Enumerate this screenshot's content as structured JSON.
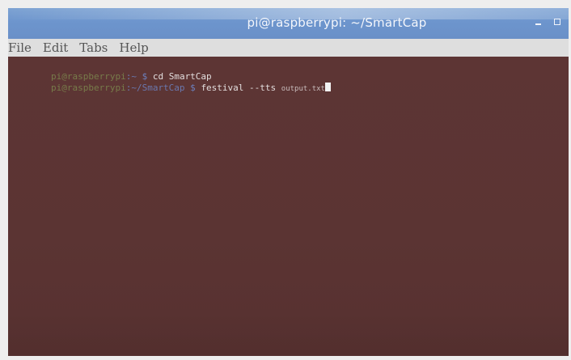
{
  "window": {
    "title": "pi@raspberrypi: ~/SmartCap",
    "controls": {
      "minimize_icon": "minimize-icon",
      "maximize_icon": "maximize-icon"
    }
  },
  "menu": {
    "items": [
      {
        "label": "File"
      },
      {
        "label": "Edit"
      },
      {
        "label": "Tabs"
      },
      {
        "label": "Help"
      }
    ]
  },
  "terminal": {
    "lines": [
      {
        "user": "pi@raspberrypi",
        "path": ":~",
        "symbol": " $ ",
        "command": "cd SmartCap",
        "arg": ""
      },
      {
        "user": "pi@raspberrypi",
        "path": ":~/SmartCap",
        "symbol": " $ ",
        "command": "festival --tts ",
        "arg": "output.txt"
      }
    ]
  },
  "colors": {
    "terminal_bg": "#5d3534",
    "titlebar": "#6d95cd",
    "menubar": "#dedede"
  }
}
